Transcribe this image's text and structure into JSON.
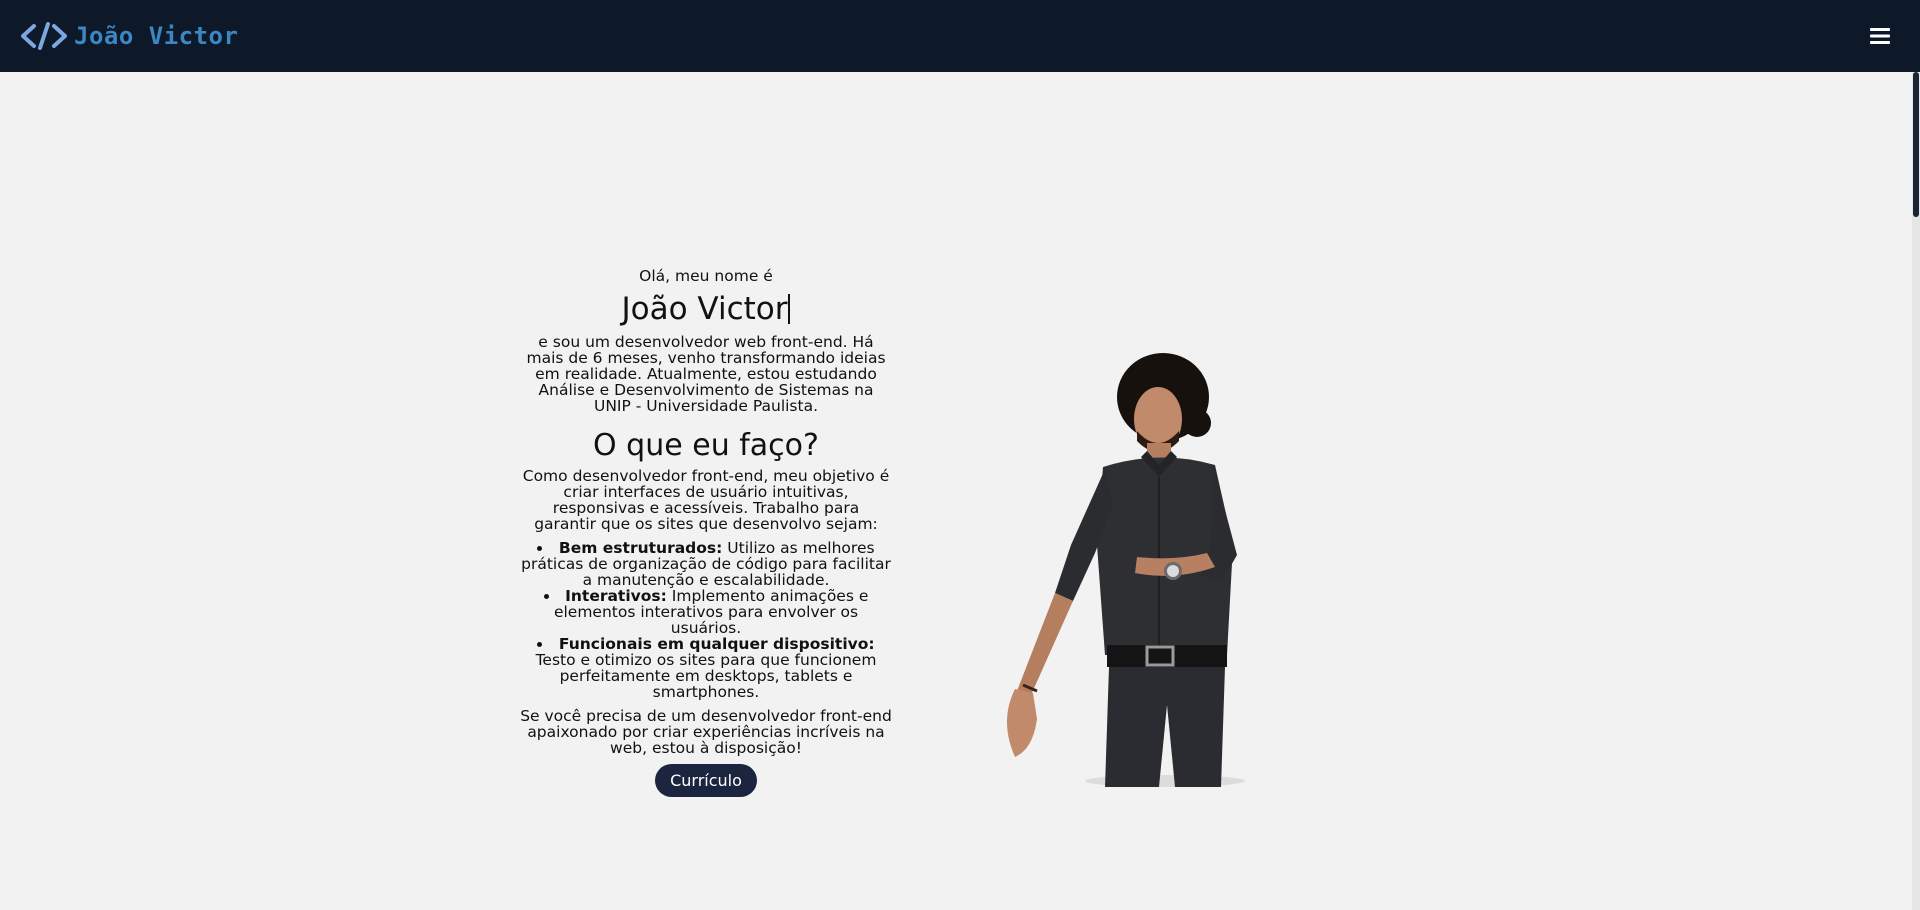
{
  "header": {
    "brand_name": "João Victor",
    "logo_icon": "code-brackets-icon",
    "menu_icon": "hamburger-menu-icon"
  },
  "hero": {
    "greeting": "Olá, meu nome é",
    "name": "João Victor",
    "description": "e sou um desenvolvedor web front-end. Há mais de 6 meses, venho transformando ideias em realidade. Atualmente, estou estudando Análise e Desenvolvimento de Sistemas na UNIP - Universidade Paulista."
  },
  "services": {
    "title": "O que eu faço?",
    "intro": "Como desenvolvedor front-end, meu objetivo é criar interfaces de usuário intuitivas, responsivas e acessíveis. Trabalho para garantir que os sites que desenvolvo sejam:",
    "items": [
      {
        "title": "Bem estruturados:",
        "text": "Utilizo as melhores práticas de organização de código para facilitar a manutenção e escalabilidade."
      },
      {
        "title": "Interativos:",
        "text": "Implemento animações e elementos interativos para envolver os usuários."
      },
      {
        "title": "Funcionais em qualquer dispositivo:",
        "text": "Testo e otimizo os sites para que funcionem perfeitamente em desktops, tablets e smartphones."
      }
    ],
    "closing": "Se você precisa de um desenvolvedor front-end apaixonado por criar experiências incríveis na web, estou à disposição!"
  },
  "actions": {
    "resume_button": "Currículo"
  },
  "colors": {
    "nav_bg": "#0d1828",
    "brand_text": "#3c87c3",
    "logo_icon": "#7aa7df",
    "page_bg": "#f2f2f2",
    "button_bg": "#1b2540"
  }
}
